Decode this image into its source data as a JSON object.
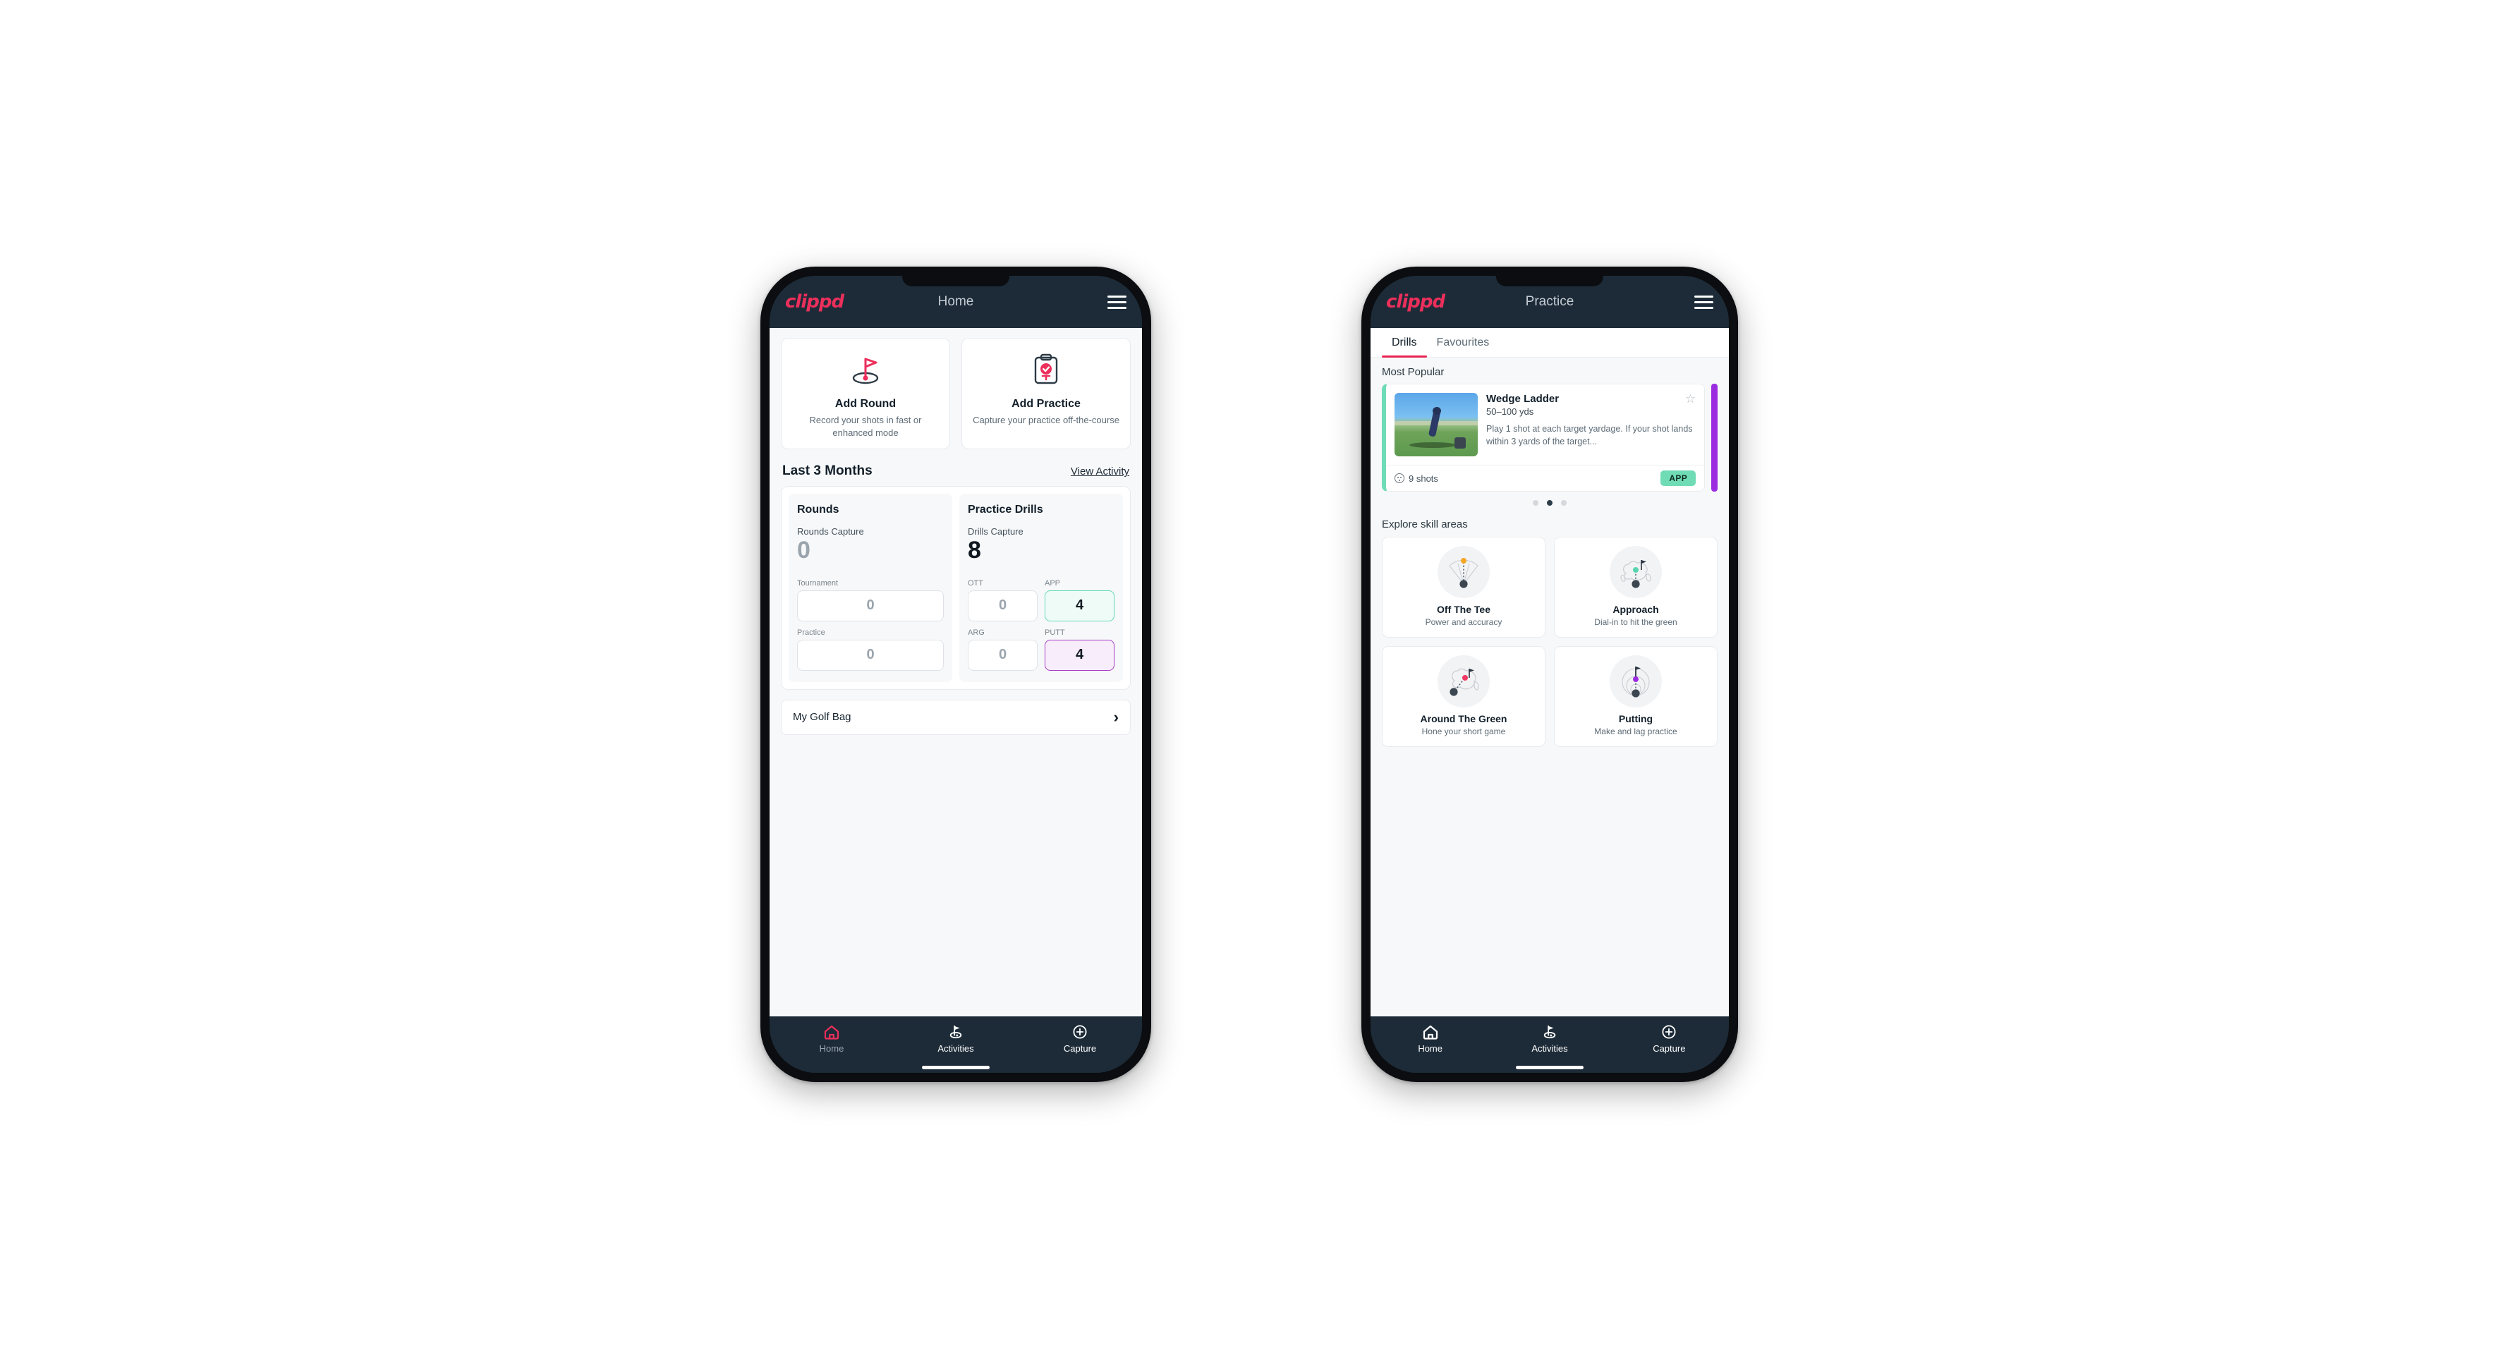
{
  "phones": [
    {
      "id": "home-phone",
      "appbar": {
        "logo": "clippd",
        "title": "Home",
        "menu_icon": "hamburger-icon"
      },
      "quick_actions": [
        {
          "icon": "golf-flag-icon",
          "title": "Add Round",
          "subtitle": "Record your shots in fast or enhanced mode"
        },
        {
          "icon": "clipboard-check-icon",
          "title": "Add Practice",
          "subtitle": "Capture your practice off-the-course"
        }
      ],
      "section": {
        "title": "Last 3 Months",
        "link": "View Activity"
      },
      "rounds": {
        "heading": "Rounds",
        "capture_label": "Rounds Capture",
        "capture_value": "0",
        "fields": [
          {
            "label": "Tournament",
            "value": "0"
          },
          {
            "label": "Practice",
            "value": "0"
          }
        ]
      },
      "drills": {
        "heading": "Practice Drills",
        "capture_label": "Drills Capture",
        "capture_value": "8",
        "tiles": [
          {
            "label": "OTT",
            "value": "0",
            "style": "plain"
          },
          {
            "label": "APP",
            "value": "4",
            "style": "teal"
          },
          {
            "label": "ARG",
            "value": "0",
            "style": "plain"
          },
          {
            "label": "PUTT",
            "value": "4",
            "style": "purple"
          }
        ]
      },
      "golf_bag": {
        "label": "My Golf Bag",
        "chevron": "chevron-right-icon"
      },
      "bottom_nav": {
        "active_index": 1,
        "items": [
          {
            "icon": "home-icon",
            "label": "Home",
            "highlight": true
          },
          {
            "icon": "golf-flag-icon",
            "label": "Activities",
            "highlight": false
          },
          {
            "icon": "plus-circle-icon",
            "label": "Capture",
            "highlight": false
          }
        ]
      }
    },
    {
      "id": "practice-phone",
      "appbar": {
        "logo": "clippd",
        "title": "Practice",
        "menu_icon": "hamburger-icon"
      },
      "tabs": [
        {
          "label": "Drills",
          "active": true
        },
        {
          "label": "Favourites",
          "active": false
        }
      ],
      "most_popular": {
        "heading": "Most Popular"
      },
      "drill": {
        "title": "Wedge Ladder",
        "subtitle": "50–100 yds",
        "description": "Play 1 shot at each target yardage. If your shot lands within 3 yards of the target...",
        "shots": "9 shots",
        "badge": "APP",
        "star_icon": "star-outline-icon",
        "accent_color": "#6edcb6",
        "peek_color": "#9b2ce0"
      },
      "pagination": {
        "count": 3,
        "active_index": 1
      },
      "skill_section": {
        "heading": "Explore skill areas"
      },
      "skill_areas": [
        {
          "icon": "tee-shot-fan-icon",
          "title": "Off The Tee",
          "subtitle": "Power and accuracy",
          "dot_color": "#f5a623"
        },
        {
          "icon": "green-approach-icon",
          "title": "Approach",
          "subtitle": "Dial-in to hit the green",
          "dot_color": "#5ad3b0"
        },
        {
          "icon": "chip-green-icon",
          "title": "Around The Green",
          "subtitle": "Hone your short game",
          "dot_color": "#ee3a63"
        },
        {
          "icon": "putt-rings-icon",
          "title": "Putting",
          "subtitle": "Make and lag practice",
          "dot_color": "#9b2ce0"
        }
      ],
      "bottom_nav": {
        "active_index": 1,
        "items": [
          {
            "icon": "home-icon",
            "label": "Home",
            "highlight": false
          },
          {
            "icon": "golf-flag-icon",
            "label": "Activities",
            "highlight": false
          },
          {
            "icon": "plus-circle-icon",
            "label": "Capture",
            "highlight": false
          }
        ]
      }
    }
  ],
  "colors": {
    "brand_pink": "#ec2f5b",
    "navy": "#1d2b38",
    "teal": "#6edcb6",
    "purple": "#9b2ce0",
    "tab_underline": "#e8224f"
  }
}
